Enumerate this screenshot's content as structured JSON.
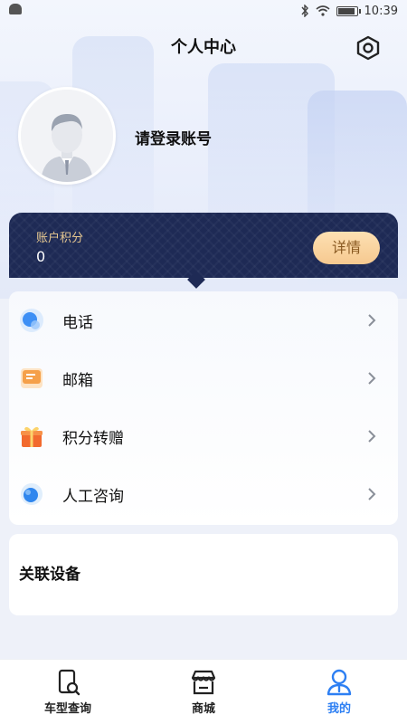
{
  "status_bar": {
    "time": "10:39"
  },
  "header": {
    "title": "个人中心"
  },
  "profile": {
    "login_prompt": "请登录账号"
  },
  "points": {
    "label": "账户积分",
    "value": "0",
    "detail_button": "详情"
  },
  "menu": {
    "items": [
      {
        "label": "电话",
        "icon": "phone-icon"
      },
      {
        "label": "邮箱",
        "icon": "mail-icon"
      },
      {
        "label": "积分转赠",
        "icon": "gift-icon"
      },
      {
        "label": "人工咨询",
        "icon": "chat-icon"
      }
    ]
  },
  "device": {
    "title": "关联设备"
  },
  "tabbar": {
    "tabs": [
      {
        "label": "车型查询",
        "icon": "car-search-icon"
      },
      {
        "label": "商城",
        "icon": "store-icon"
      },
      {
        "label": "我的",
        "icon": "user-icon",
        "active": true
      }
    ],
    "active_color": "#2d7ff3"
  },
  "colors": {
    "points_card": "#1e2a55",
    "detail_button": "#f6c990",
    "accent": "#2d7ff3"
  }
}
